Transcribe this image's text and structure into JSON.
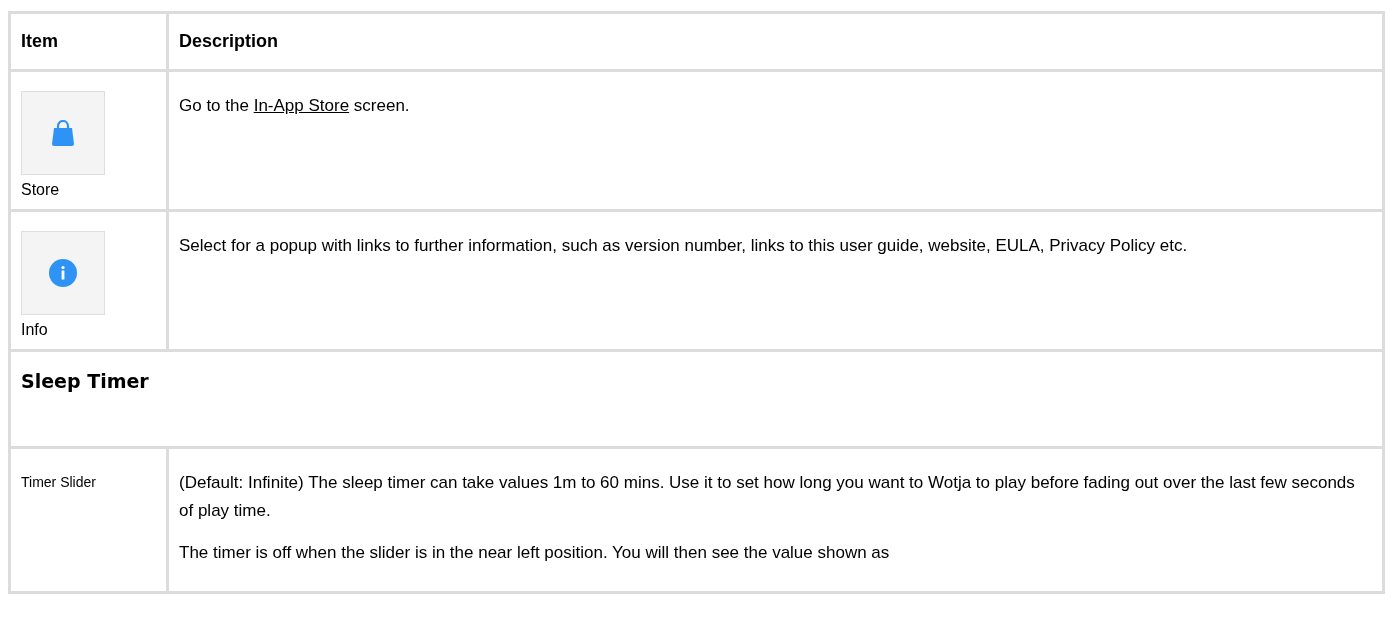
{
  "table": {
    "columns": [
      "Item",
      "Description"
    ],
    "rows": [
      {
        "kind": "icon",
        "label": "Store",
        "paragraphs": [
          [
            {
              "kind": "text",
              "text": "Go to the "
            },
            {
              "kind": "link",
              "text": "In-App Store"
            },
            {
              "kind": "text",
              "text": " screen."
            }
          ]
        ]
      },
      {
        "kind": "icon",
        "label": "Info",
        "paragraphs": [
          [
            {
              "kind": "text",
              "text": "Select for a popup with links to further information, such as version number, links to this user guide, website, EULA, Privacy Policy etc."
            }
          ]
        ]
      },
      {
        "kind": "section",
        "label": "Sleep Timer"
      },
      {
        "kind": "text",
        "label": "Timer Slider",
        "paragraphs": [
          [
            {
              "kind": "text",
              "text": "(Default: Infinite) The sleep timer can take values 1m to 60 mins. Use it to set how long you want to Wotja to play before fading out over the last few seconds of play time."
            }
          ],
          [
            {
              "kind": "text",
              "text": "The timer is off when the slider is in the near left position. You will then see the value shown as"
            }
          ]
        ]
      }
    ]
  }
}
